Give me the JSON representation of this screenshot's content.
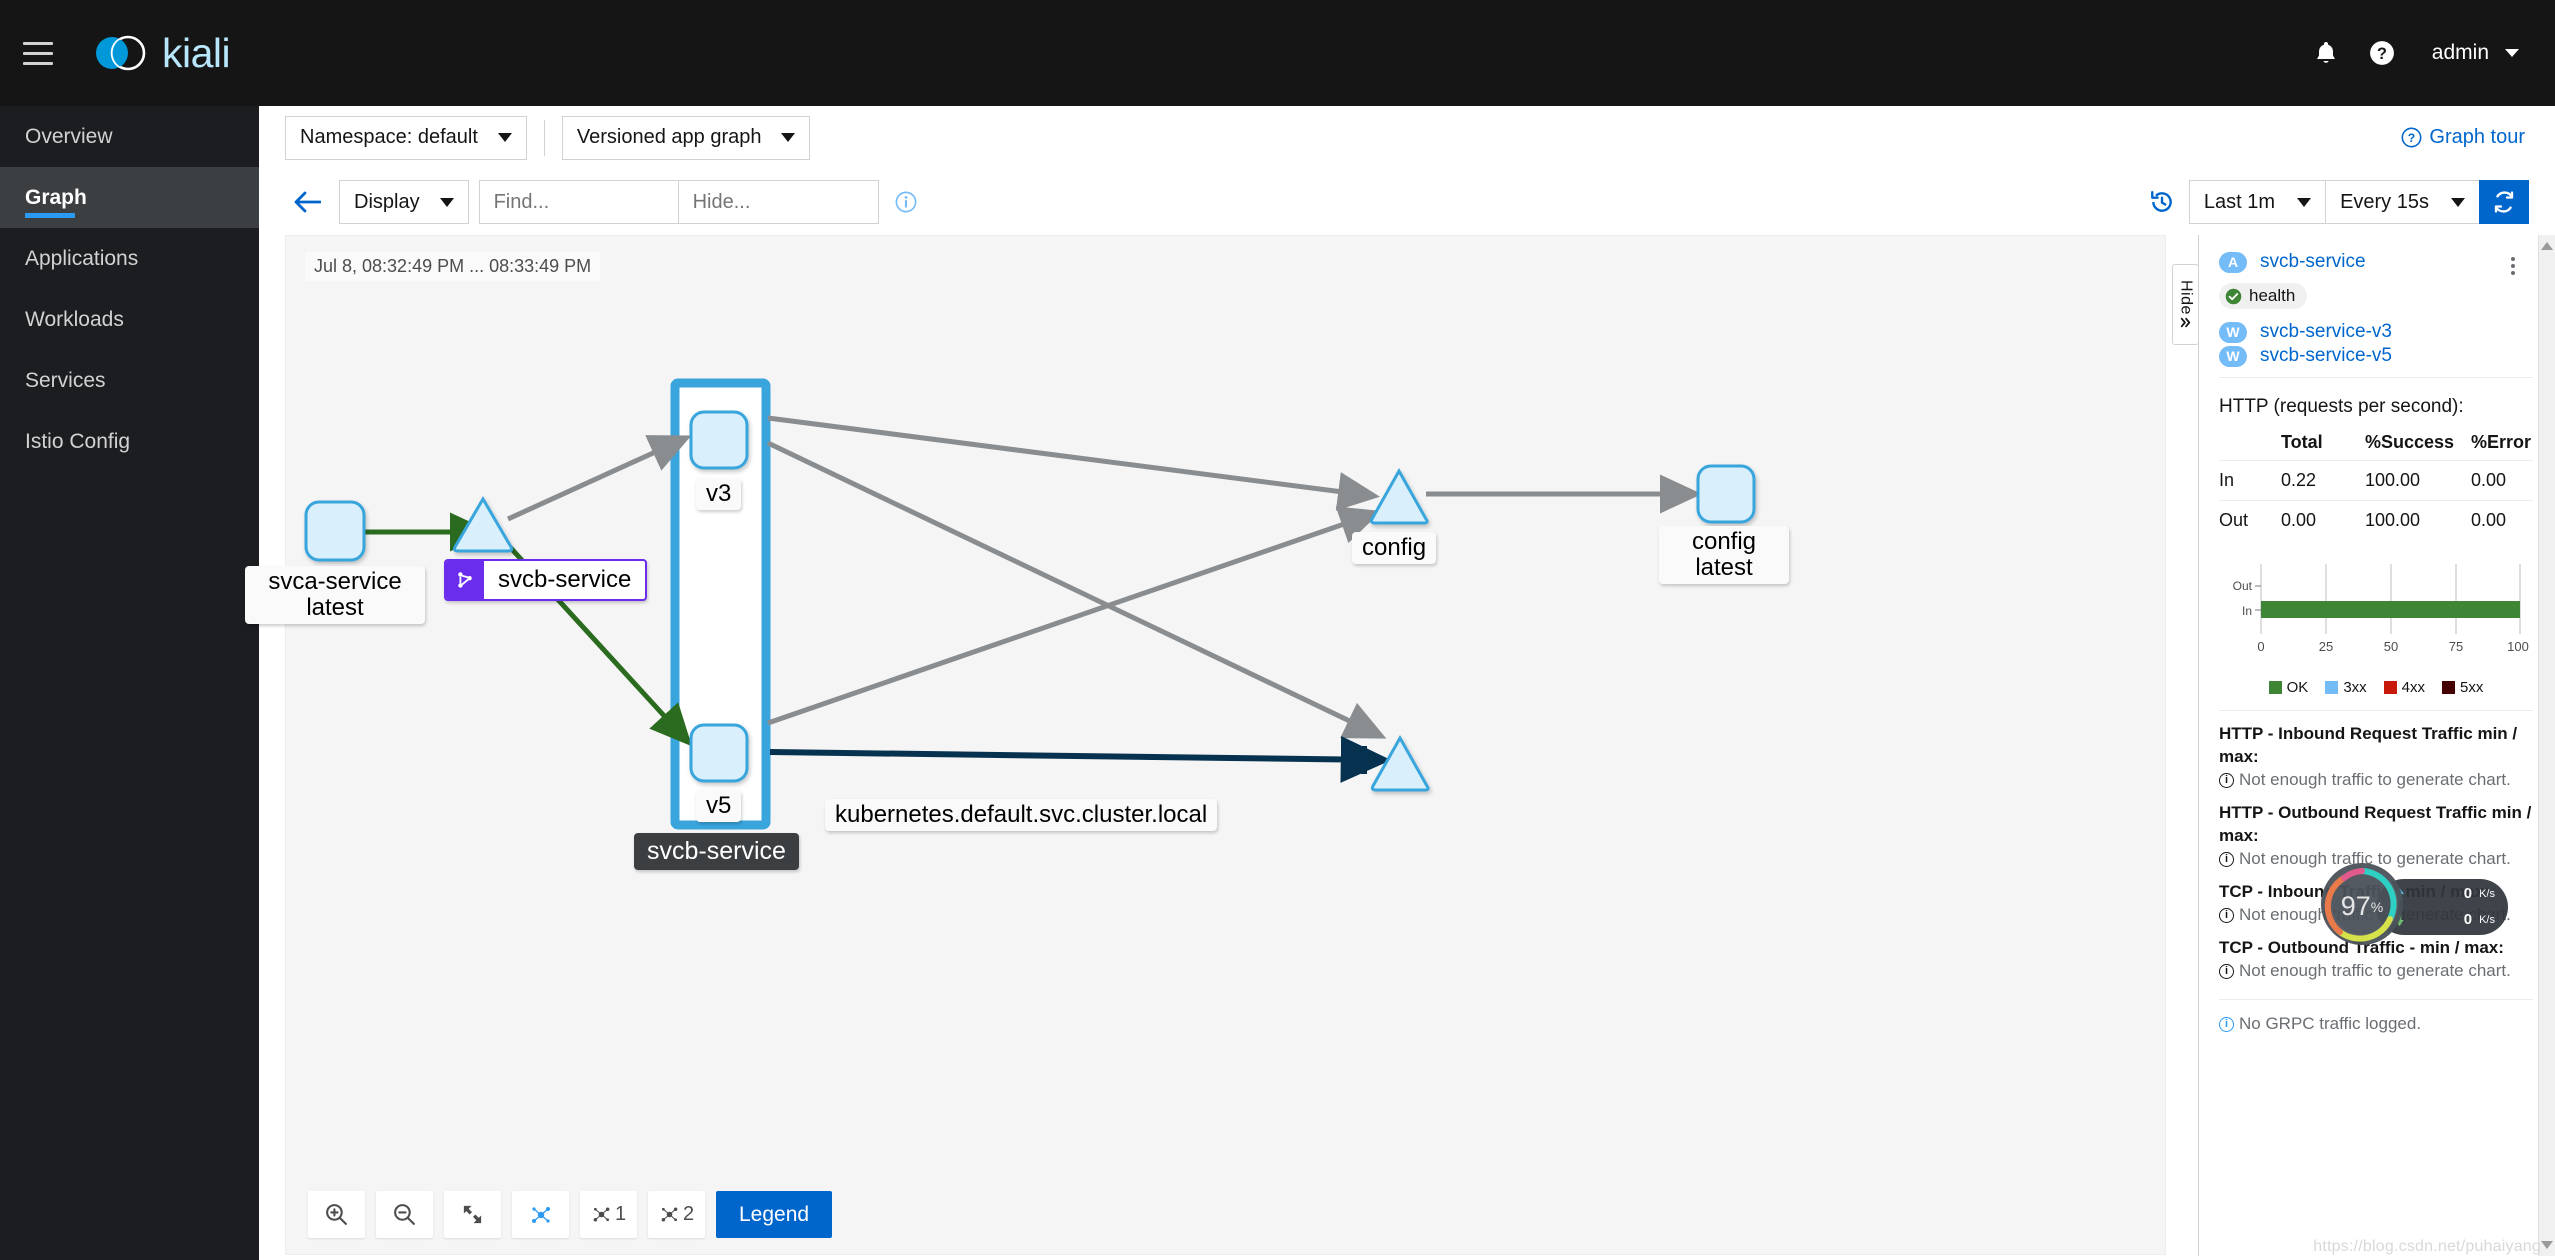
{
  "masthead": {
    "brand": "kiali",
    "menu_icon": "hamburger-icon",
    "notifications_icon": "bell-icon",
    "help_icon": "question-circle-icon",
    "user": "admin"
  },
  "sidebar": {
    "items": [
      {
        "label": "Overview",
        "active": false
      },
      {
        "label": "Graph",
        "active": true
      },
      {
        "label": "Applications",
        "active": false
      },
      {
        "label": "Workloads",
        "active": false
      },
      {
        "label": "Services",
        "active": false
      },
      {
        "label": "Istio Config",
        "active": false
      }
    ]
  },
  "toolbar": {
    "namespace": "Namespace: default",
    "graph_type": "Versioned app graph",
    "graph_tour": "Graph tour",
    "display": "Display",
    "find_placeholder": "Find...",
    "hide_placeholder": "Hide...",
    "find_value": "",
    "hide_value": "",
    "duration": "Last 1m",
    "refresh_interval": "Every 15s",
    "refresh_icon": "sync-icon",
    "history_icon": "history-icon",
    "back_icon": "arrow-left-icon",
    "info_icon": "info-circle-icon"
  },
  "graph": {
    "time_range": "Jul 8, 08:32:49 PM ... 08:33:49 PM",
    "hide_tab_label": "Hide",
    "hide_tab_icon": "chevron-double-right-icon",
    "nodes": [
      {
        "id": "svca",
        "label": "svca-service\nlatest",
        "shape": "app-box"
      },
      {
        "id": "svcb-svc",
        "label": "svcb-service",
        "shape": "service-triangle",
        "badge": "virtualservice-icon"
      },
      {
        "id": "v3",
        "label": "v3",
        "shape": "app-box"
      },
      {
        "id": "v5",
        "label": "v5",
        "shape": "app-box"
      },
      {
        "id": "config",
        "label": "config",
        "shape": "service-triangle"
      },
      {
        "id": "config-latest",
        "label": "config\nlatest",
        "shape": "app-box"
      },
      {
        "id": "kubernetes",
        "label": "kubernetes.default.svc.cluster.local",
        "shape": "service-triangle"
      }
    ],
    "group_box_label": "svcb-service",
    "tools": [
      {
        "name": "zoom-in",
        "label": ""
      },
      {
        "name": "zoom-out",
        "label": ""
      },
      {
        "name": "fit-to-screen",
        "label": ""
      },
      {
        "name": "layout-default",
        "label": ""
      },
      {
        "name": "layout-1",
        "label": "1"
      },
      {
        "name": "layout-2",
        "label": "2"
      }
    ],
    "legend_button": "Legend"
  },
  "panel": {
    "app_badge": "A",
    "app_name": "svcb-service",
    "health_label": "health",
    "workloads": [
      {
        "badge": "W",
        "name": "svcb-service-v3"
      },
      {
        "badge": "W",
        "name": "svcb-service-v5"
      }
    ],
    "http_title": "HTTP (requests per second):",
    "table": {
      "headers": [
        "",
        "Total",
        "%Success",
        "%Error"
      ],
      "rows": [
        [
          "In",
          "0.22",
          "100.00",
          "0.00"
        ],
        [
          "Out",
          "0.00",
          "100.00",
          "0.00"
        ]
      ]
    },
    "traffic_sections": [
      {
        "title": "HTTP - Inbound Request Traffic min / max:",
        "message": "Not enough traffic to generate chart."
      },
      {
        "title": "HTTP - Outbound Request Traffic min / max:",
        "message": "Not enough traffic to generate chart."
      },
      {
        "title": "TCP - Inbound Traffic - min / max:",
        "message": "Not enough traffic to generate chart."
      },
      {
        "title": "TCP - Outbound Traffic - min / max:",
        "message": "Not enough traffic to generate chart."
      }
    ],
    "grpc_message": "No GRPC traffic logged.",
    "kebab_icon": "ellipsis-vertical-icon"
  },
  "chart_data": {
    "type": "bar",
    "orientation": "horizontal",
    "title": "",
    "categories": [
      "Out",
      "In"
    ],
    "series": [
      {
        "name": "OK",
        "color": "#3e8635",
        "values": [
          0,
          100
        ]
      },
      {
        "name": "3xx",
        "color": "#73bcf7",
        "values": [
          0,
          0
        ]
      },
      {
        "name": "4xx",
        "color": "#c9190b",
        "values": [
          0,
          0
        ]
      },
      {
        "name": "5xx",
        "color": "#470000",
        "values": [
          0,
          0
        ]
      }
    ],
    "xlabel": "",
    "ylabel": "",
    "xlim": [
      0,
      100
    ],
    "xticks": [
      0,
      25,
      50,
      75,
      100
    ],
    "xticklabels": [
      "0",
      "25",
      "50",
      "75",
      "100"
    ],
    "grid": true,
    "legend_position": "bottom",
    "legend": [
      "OK",
      "3xx",
      "4xx",
      "5xx"
    ]
  },
  "overlay_widget": {
    "percent": "97",
    "percent_unit": "%",
    "up_value": "0",
    "up_unit": "K/s",
    "down_value": "0",
    "down_unit": "K/s",
    "up_icon": "arrow-up-icon",
    "down_icon": "arrow-down-icon"
  },
  "watermark": "https://blog.csdn.net/puhaiyang"
}
